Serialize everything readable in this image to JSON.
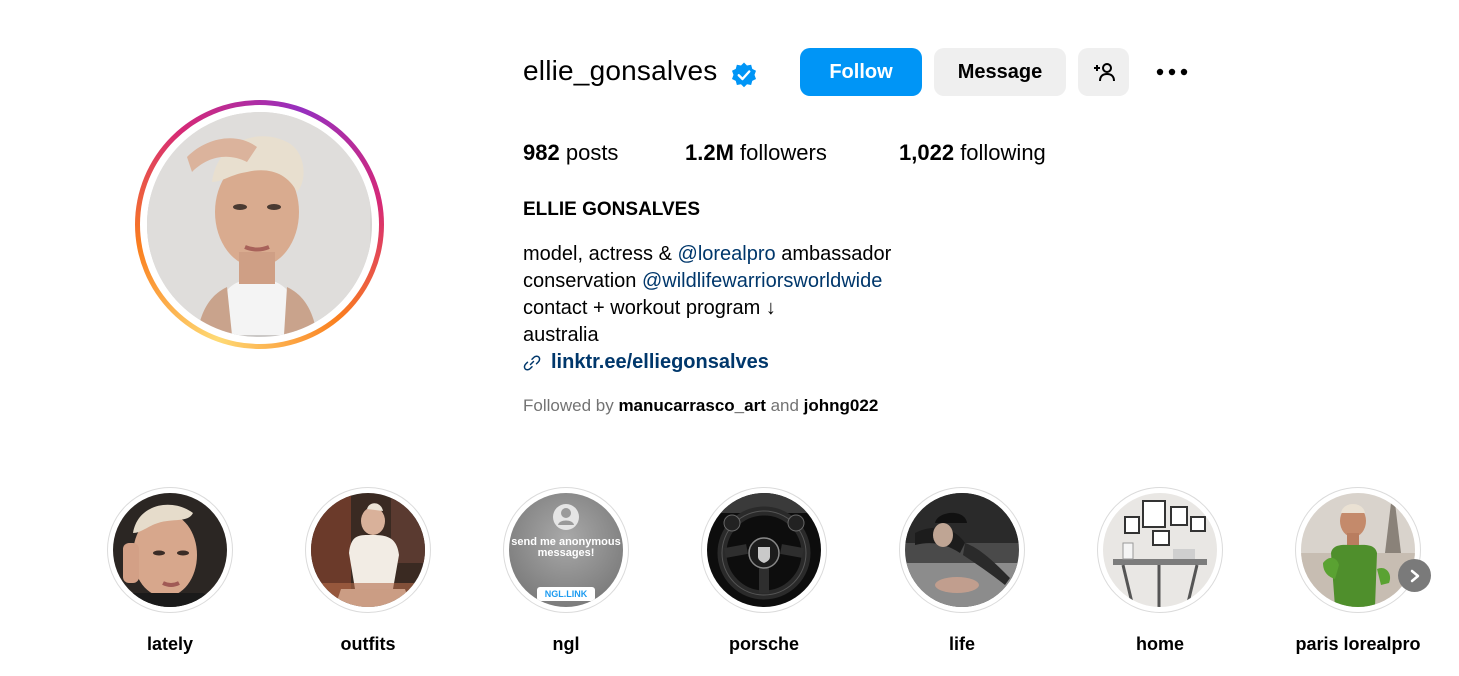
{
  "profile": {
    "username": "ellie_gonsalves",
    "full_name": "ELLIE GONSALVES",
    "verified_icon": "verified-badge-icon",
    "accent_color": "#0095f6"
  },
  "actions": {
    "follow_label": "Follow",
    "message_label": "Message",
    "add_user_icon": "person-plus-icon",
    "more_icon": "ellipsis-icon"
  },
  "stats": {
    "posts_count": "982",
    "posts_label": "posts",
    "followers_count": "1.2M",
    "followers_label": "followers",
    "following_count": "1,022",
    "following_label": "following"
  },
  "bio": {
    "line1_pre": "model, actress & ",
    "line1_mention": "@lorealpro",
    "line1_post": " ambassador",
    "line2_pre": "conservation ",
    "line2_mention": "@wildlifewarriorsworldwide",
    "line3": "contact + workout program ↓",
    "line4": "australia",
    "link_icon": "link-icon",
    "link": "linktr.ee/elliegonsalves"
  },
  "followed_by": {
    "prefix": "Followed by ",
    "user1": "manucarrasco_art",
    "conjunction": " and ",
    "user2": "johng022"
  },
  "highlights": [
    {
      "label": "lately"
    },
    {
      "label": "outfits"
    },
    {
      "label": "ngl",
      "overlay_text": "send me anonymous messages!",
      "badge": "NGL.LINK"
    },
    {
      "label": "porsche"
    },
    {
      "label": "life"
    },
    {
      "label": "home"
    },
    {
      "label": "paris lorealpro"
    }
  ],
  "highlights_next_icon": "chevron-right-icon"
}
